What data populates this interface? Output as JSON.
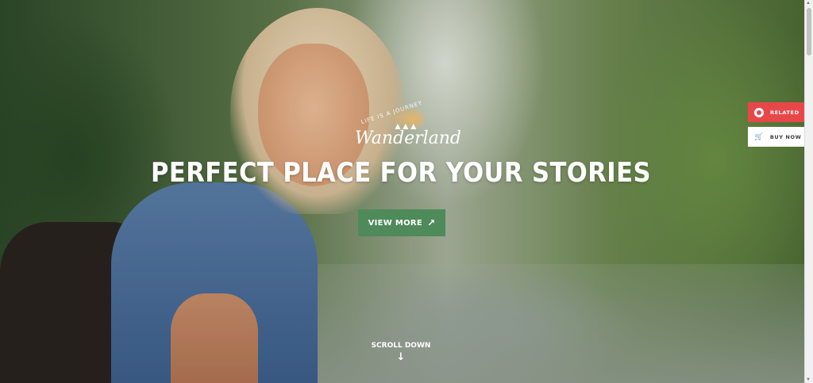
{
  "logo": {
    "tagline": "LIFE IS A JOURNEY",
    "name": "Wanderland"
  },
  "hero": {
    "headline": "PERFECT PLACE FOR YOUR STORIES",
    "cta_label": "VIEW MORE",
    "scroll_label": "SCROLL DOWN"
  },
  "side_buttons": {
    "related": "RELATED",
    "buy_now": "BUY NOW"
  },
  "colors": {
    "cta_green": "#4f8a5a",
    "related_red": "#e8474a"
  },
  "icons": {
    "cta": "arrow-up-right-icon",
    "scroll": "arrow-down-icon",
    "related": "related-circle-icon",
    "buy": "cart-icon"
  }
}
